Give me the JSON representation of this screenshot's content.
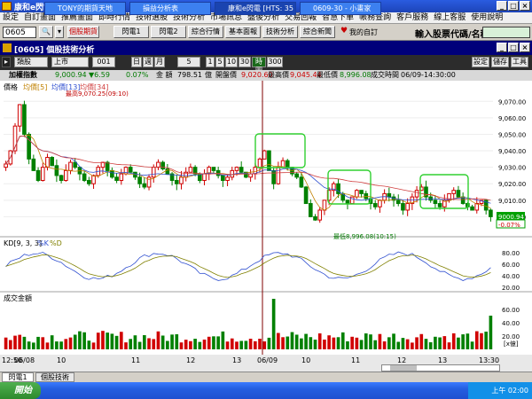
{
  "window": {
    "title": "康和e閃電 [HTS: 35 38]"
  },
  "menu": [
    "設定",
    "自訂畫面",
    "推薦畫面",
    "即時行情",
    "技術選股",
    "技術分析",
    "市場訊息",
    "盤後分析",
    "交易回報",
    "智慧下單",
    "帳務查詢",
    "客戶服務",
    "線上客服",
    "使用說明"
  ],
  "toolbar": {
    "code": "0605",
    "buttons": [
      "個股期貨",
      "閃電1",
      "閃電2",
      "綜合行情",
      "基本面報",
      "技術分析",
      "綜合新聞"
    ],
    "favorite": "我的自訂",
    "prompt": "輸入股票代碼/名稱:"
  },
  "panel": {
    "title": "[0605] 個股技術分析",
    "controls": {
      "type": "類股",
      "market": "上市",
      "code": "001",
      "periods": [
        "日",
        "週",
        "月"
      ],
      "interval": "5",
      "mins": [
        "1",
        "5",
        "10",
        "30"
      ],
      "tick": "時圖",
      "count": "300"
    },
    "buttons": [
      "設定",
      "儲存",
      "工具"
    ]
  },
  "info": {
    "name": "加權指數",
    "price": "9,000.94",
    "change": "▼6.59",
    "pct": "0.07%",
    "amount_label": "金 額",
    "amount": "798.51",
    "amount_unit": "億",
    "open_label": "開盤價",
    "open": "9,020.60",
    "high_label": "最高價",
    "high": "9,045.44",
    "low_label": "最低價",
    "low": "8,996.08",
    "time_label": "成交時間",
    "time": "06/09-14:30:00"
  },
  "chart_data": [
    {
      "type": "candlestick",
      "title": "價格",
      "legend": [
        "均價[5]",
        "均價[13]",
        "均價[34]"
      ],
      "ylim": [
        8990,
        9075
      ],
      "yticks": [
        "9,070.00",
        "9,060.00",
        "9,050.00",
        "9,040.00",
        "9,030.00",
        "9,020.00",
        "9,010.00",
        "9,000.00"
      ],
      "annotations": [
        "最高9,070.25(09:10)",
        "最低8,996.08(10:15)"
      ],
      "last_label": [
        "9000.94",
        "-0.07%"
      ],
      "xticks": [
        "12:50",
        "06/08",
        "10",
        "11",
        "12",
        "13",
        "06/09",
        "10",
        "11",
        "12",
        "13",
        "13:30"
      ]
    },
    {
      "type": "line",
      "title": "KD[9, 3, 3]",
      "legend": [
        "%K",
        "%D"
      ],
      "yticks": [
        "80.00",
        "60.00",
        "40.00",
        "20.00"
      ]
    },
    {
      "type": "bar",
      "title": "成交金額",
      "yticks": [
        "60.00",
        "40.00",
        "20.00"
      ],
      "unit": "[x億]"
    }
  ],
  "tabs": [
    "閃電1",
    "個股技術"
  ],
  "taskbar": {
    "start": "開始",
    "tasks": [
      "TONY的期貨天地",
      "損益分析表",
      "康和e閃電 [HTS: 35 ...",
      "0609-30 - 小畫家"
    ],
    "clock": "上午 02:00"
  }
}
